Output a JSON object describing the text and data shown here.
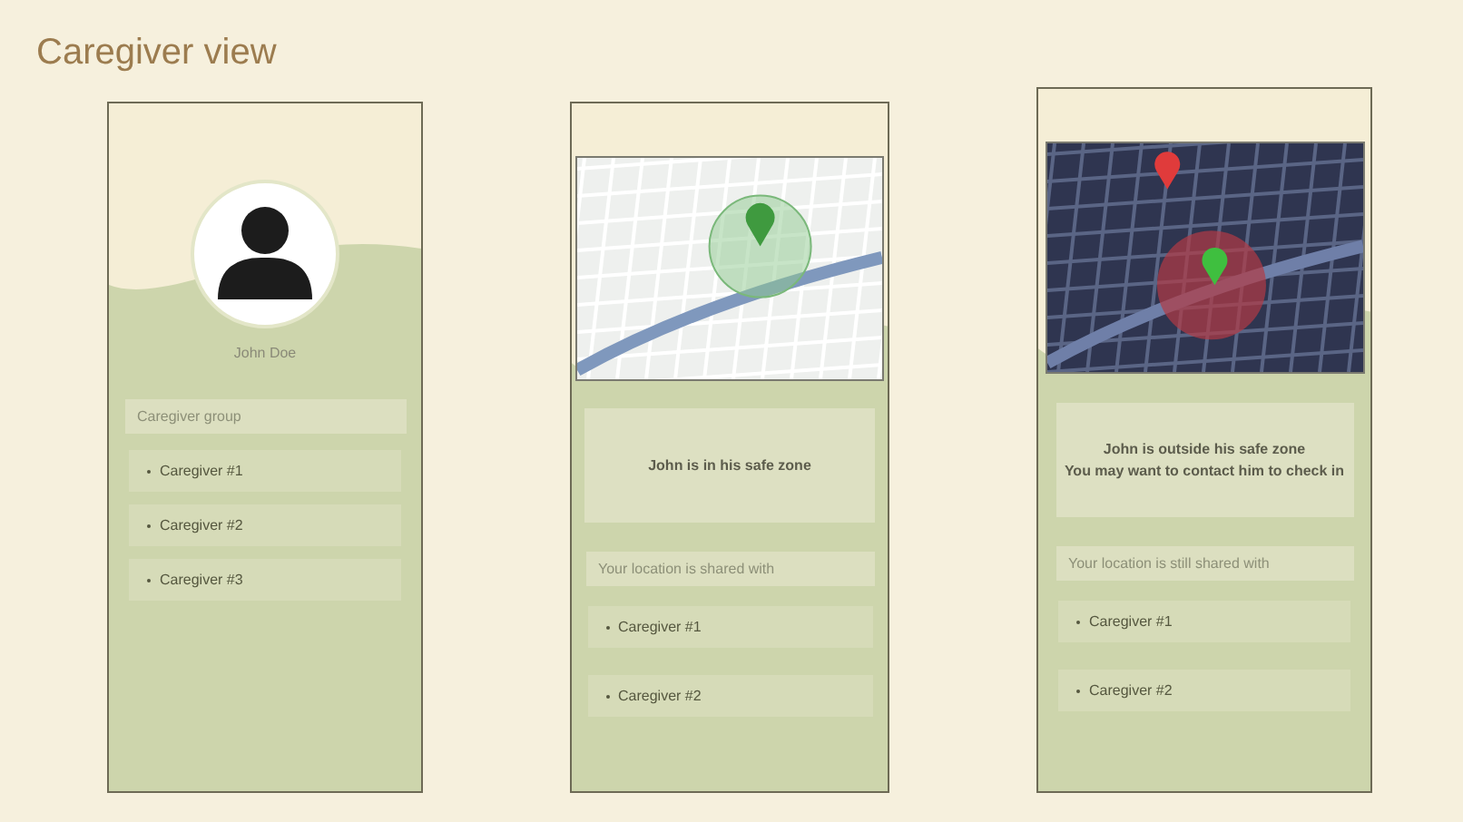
{
  "title": "Caregiver view",
  "screens": [
    {
      "kind": "profile",
      "name": "John Doe",
      "list_label": "Caregiver group",
      "items": [
        "Caregiver #1",
        "Caregiver #2",
        "Caregiver #3"
      ]
    },
    {
      "kind": "map",
      "safe": true,
      "message": "John is in his safe zone",
      "list_label": "Your location is shared with",
      "items": [
        "Caregiver #1",
        "Caregiver #2"
      ]
    },
    {
      "kind": "map",
      "safe": false,
      "message": "John is outside his safe zone\nYou may want to contact him to check in",
      "list_label": "Your location is still shared with",
      "items": [
        "Caregiver #1",
        "Caregiver #2"
      ]
    }
  ]
}
